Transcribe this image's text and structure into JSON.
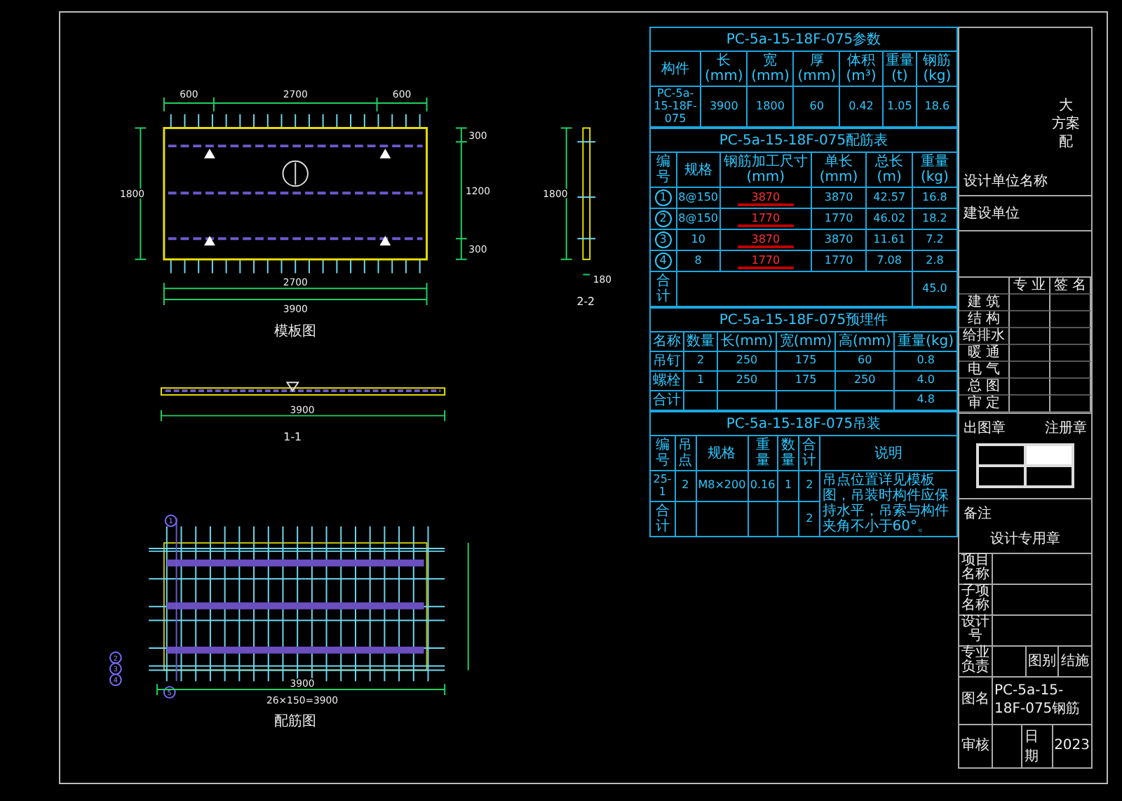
{
  "views": [
    {
      "kind": "plan",
      "caption": "模板图",
      "dims": [
        "600",
        "2700",
        "600",
        "2700",
        "3900",
        "1800",
        "300",
        "1200",
        "300"
      ]
    },
    {
      "kind": "side",
      "caption": "2-2",
      "dims": [
        "1800",
        "180"
      ]
    },
    {
      "kind": "section",
      "caption": "1-1",
      "dims": [
        "3900"
      ]
    },
    {
      "kind": "rebar",
      "caption": "配筋图",
      "dims": [
        "3900",
        "26×150=3900"
      ],
      "marks": [
        "1",
        "2",
        "3",
        "4",
        "5"
      ]
    }
  ],
  "tables": [
    {
      "kind": "params",
      "title": "PC-5a-15-18F-075参数",
      "headers": [
        "构件",
        "长(mm)",
        "宽(mm)",
        "厚(mm)",
        "体积(m³)",
        "重量(t)",
        "钢筋(kg)"
      ],
      "rows": [
        [
          "PC-5a-15-18F-075",
          "3900",
          "1800",
          "60",
          "0.42",
          "1.05",
          "18.6"
        ]
      ]
    },
    {
      "kind": "rebar",
      "title": "PC-5a-15-18F-075配筋表",
      "headers": [
        "编号",
        "规格",
        "钢筋加工尺寸(mm)",
        "单长(mm)",
        "总长(m)",
        "重量(kg)"
      ],
      "rows": [
        {
          "mark": "1",
          "spec": "8@150",
          "shape": "3870",
          "len": "3870",
          "total": "42.57",
          "weight": "16.8"
        },
        {
          "mark": "2",
          "spec": "8@150",
          "shape": "1770",
          "len": "1770",
          "total": "46.02",
          "weight": "18.2"
        },
        {
          "mark": "3",
          "spec": "10",
          "shape": "3870",
          "len": "3870",
          "total": "11.61",
          "weight": "7.2"
        },
        {
          "mark": "4",
          "spec": "8",
          "shape": "1770",
          "len": "1770",
          "total": "7.08",
          "weight": "2.8"
        }
      ],
      "total": [
        "合计",
        "45.0"
      ]
    },
    {
      "kind": "parts",
      "title": "PC-5a-15-18F-075预埋件",
      "headers": [
        "名称",
        "数量",
        "长(mm)",
        "宽(mm)",
        "高(mm)",
        "重量(kg)"
      ],
      "rows": [
        [
          "吊钉",
          "2",
          "250",
          "175",
          "60",
          "0.8"
        ],
        [
          "螺栓",
          "1",
          "250",
          "175",
          "250",
          "4.0"
        ],
        [
          "合计",
          "",
          "",
          "",
          "",
          "4.8"
        ]
      ]
    },
    {
      "kind": "lift",
      "title": "PC-5a-15-18F-075吊装",
      "headers": [
        "编号",
        "吊点",
        "规格",
        "重量",
        "数量",
        "合计",
        "说明"
      ],
      "rows": [
        [
          "25-1",
          "2",
          "M8×200",
          "0.16",
          "1",
          "2"
        ],
        [
          "合计",
          "",
          "",
          "",
          "",
          "2"
        ]
      ],
      "note": "吊点位置详见模板图，吊装时构件应保持水平，吊索与构件夹角不小于60°。"
    }
  ],
  "titleblock": {
    "vertical": [
      "大",
      "方案",
      "配"
    ],
    "company": "设计单位名称",
    "owner": "建设单位",
    "sign_headers": [
      "专 业",
      "签 名"
    ],
    "sign_rows": [
      "建 筑",
      "结 构",
      "给排水",
      "暖 通",
      "电 气",
      "总 图",
      "审 定"
    ],
    "stamp_left": "出图章",
    "stamp_right": "注册章",
    "remark": "备注",
    "seal": "设计专用章",
    "rows": [
      {
        "kind": "field",
        "label": "项目名称"
      },
      {
        "kind": "field",
        "label": "子项名称"
      },
      {
        "kind": "field",
        "label": "设计号"
      },
      {
        "kind": "pair",
        "label": "专业负责",
        "key": "图别",
        "value": "结施"
      },
      {
        "kind": "title",
        "label": "图名",
        "value": "PC-5a-15-18F-075钢筋"
      },
      {
        "kind": "pair",
        "label": "审核",
        "key": "日期",
        "value": "2023"
      }
    ]
  }
}
